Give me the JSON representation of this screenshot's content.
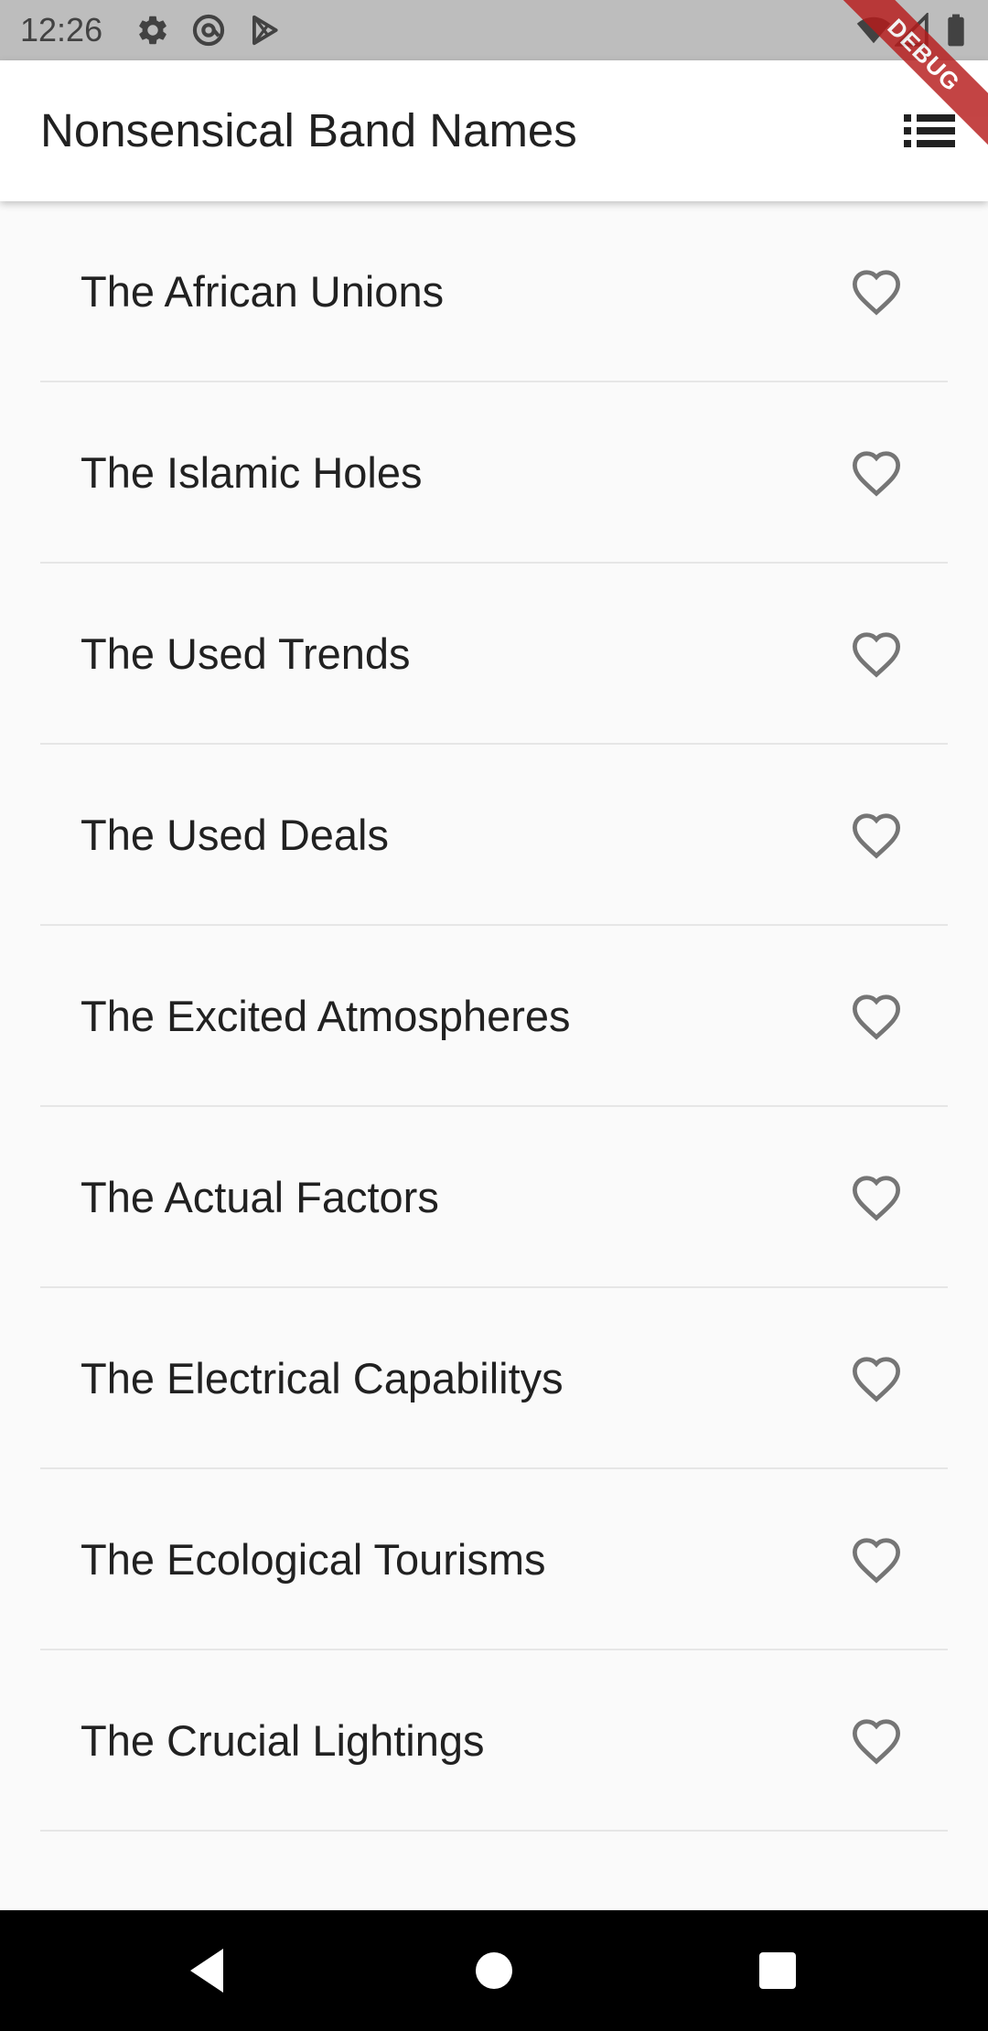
{
  "status_bar": {
    "time": "12:26",
    "icons": [
      "settings-gear-icon",
      "at-sign-icon",
      "play-store-icon",
      "wifi-icon",
      "signal-icon",
      "battery-icon"
    ]
  },
  "debug_banner": {
    "label": "DEBUG",
    "color": "#b71c1c"
  },
  "app_bar": {
    "title": "Nonsensical Band Names",
    "action_icon": "list-icon"
  },
  "list": {
    "items": [
      {
        "label": "The African Unions",
        "favorite": false
      },
      {
        "label": "The Islamic Holes",
        "favorite": false
      },
      {
        "label": "The Used Trends",
        "favorite": false
      },
      {
        "label": "The Used Deals",
        "favorite": false
      },
      {
        "label": "The Excited Atmospheres",
        "favorite": false
      },
      {
        "label": "The Actual Factors",
        "favorite": false
      },
      {
        "label": "The Electrical Capabilitys",
        "favorite": false
      },
      {
        "label": "The Ecological Tourisms",
        "favorite": false
      },
      {
        "label": "The Crucial Lightings",
        "favorite": false
      }
    ]
  },
  "nav_bar": {
    "buttons": [
      "back-icon",
      "home-icon",
      "recents-icon"
    ]
  },
  "colors": {
    "background": "#fafafa",
    "app_bar": "#ffffff",
    "status_bar": "#bdbdbd",
    "text": "#212121",
    "heart_outline": "#757575",
    "divider": "#e6e6e6",
    "nav_bar": "#000000"
  }
}
